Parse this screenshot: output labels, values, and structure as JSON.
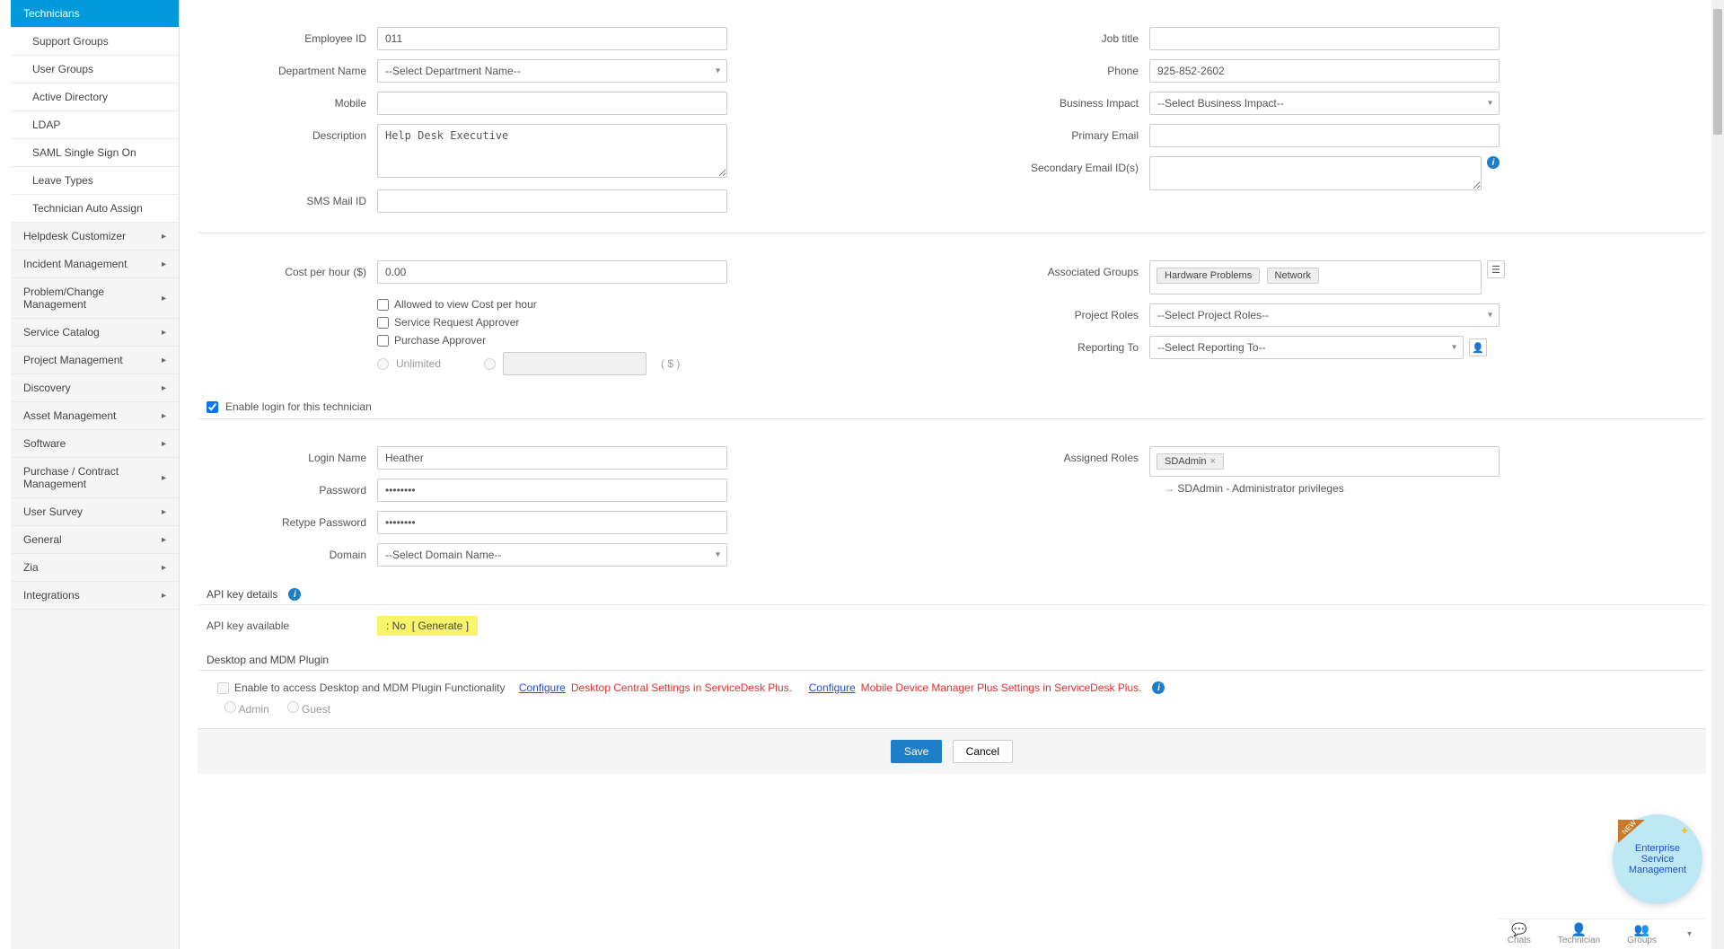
{
  "sidebar": {
    "items": [
      {
        "label": "Technicians",
        "active": true,
        "sub": false,
        "arrow": false
      },
      {
        "label": "Support Groups",
        "active": false,
        "sub": true,
        "arrow": false
      },
      {
        "label": "User Groups",
        "active": false,
        "sub": true,
        "arrow": false
      },
      {
        "label": "Active Directory",
        "active": false,
        "sub": true,
        "arrow": false
      },
      {
        "label": "LDAP",
        "active": false,
        "sub": true,
        "arrow": false
      },
      {
        "label": "SAML Single Sign On",
        "active": false,
        "sub": true,
        "arrow": false
      },
      {
        "label": "Leave Types",
        "active": false,
        "sub": true,
        "arrow": false
      },
      {
        "label": "Technician Auto Assign",
        "active": false,
        "sub": true,
        "arrow": false
      },
      {
        "label": "Helpdesk Customizer",
        "active": false,
        "sub": false,
        "arrow": true
      },
      {
        "label": "Incident Management",
        "active": false,
        "sub": false,
        "arrow": true
      },
      {
        "label": "Problem/Change Management",
        "active": false,
        "sub": false,
        "arrow": true
      },
      {
        "label": "Service Catalog",
        "active": false,
        "sub": false,
        "arrow": true
      },
      {
        "label": "Project Management",
        "active": false,
        "sub": false,
        "arrow": true
      },
      {
        "label": "Discovery",
        "active": false,
        "sub": false,
        "arrow": true
      },
      {
        "label": "Asset Management",
        "active": false,
        "sub": false,
        "arrow": true
      },
      {
        "label": "Software",
        "active": false,
        "sub": false,
        "arrow": true
      },
      {
        "label": "Purchase / Contract Management",
        "active": false,
        "sub": false,
        "arrow": true
      },
      {
        "label": "User Survey",
        "active": false,
        "sub": false,
        "arrow": true
      },
      {
        "label": "General",
        "active": false,
        "sub": false,
        "arrow": true
      },
      {
        "label": "Zia",
        "active": false,
        "sub": false,
        "arrow": true
      },
      {
        "label": "Integrations",
        "active": false,
        "sub": false,
        "arrow": true
      }
    ]
  },
  "left": {
    "employee_id": {
      "label": "Employee ID",
      "value": "011"
    },
    "department": {
      "label": "Department Name",
      "placeholder": "--Select Department Name--"
    },
    "mobile": {
      "label": "Mobile",
      "value": ""
    },
    "description": {
      "label": "Description",
      "value": "Help Desk Executive"
    },
    "sms_mail": {
      "label": "SMS Mail ID",
      "value": ""
    },
    "cost_per_hour": {
      "label": "Cost per hour ($)",
      "value": "0.00"
    },
    "checks": {
      "view_cost": "Allowed to view Cost per hour",
      "sr_approver": "Service Request Approver",
      "purchase_approver": "Purchase Approver"
    },
    "limit": {
      "unlimited_label": "Unlimited",
      "suffix": "( $ )"
    }
  },
  "right": {
    "job_title": {
      "label": "Job title",
      "value": ""
    },
    "phone": {
      "label": "Phone",
      "value": "925-852-2602"
    },
    "business_impact": {
      "label": "Business Impact",
      "placeholder": "--Select Business Impact--"
    },
    "primary_email": {
      "label": "Primary Email",
      "value": ""
    },
    "secondary_email": {
      "label": "Secondary Email ID(s)",
      "value": ""
    },
    "associated_groups": {
      "label": "Associated Groups",
      "tags": [
        "Hardware Problems",
        "Network"
      ]
    },
    "project_roles": {
      "label": "Project Roles",
      "placeholder": "--Select Project Roles--"
    },
    "reporting_to": {
      "label": "Reporting To",
      "placeholder": "--Select Reporting To--"
    }
  },
  "login": {
    "enable_label": "Enable login for this technician",
    "login_name": {
      "label": "Login Name",
      "value": "Heather"
    },
    "password": {
      "label": "Password",
      "value": "••••••••"
    },
    "retype": {
      "label": "Retype Password",
      "value": "••••••••"
    },
    "domain": {
      "label": "Domain",
      "placeholder": "--Select Domain Name--"
    },
    "assigned_roles": {
      "label": "Assigned Roles",
      "tags": [
        "SDAdmin"
      ]
    },
    "role_note": "SDAdmin - Administrator privileges"
  },
  "api": {
    "details_label": "API key details",
    "available_label": "API key available",
    "available_value": ":   No",
    "generate_text": "[ Generate ]"
  },
  "plugin": {
    "heading": "Desktop and MDM Plugin",
    "enable_label": "Enable to access Desktop and MDM Plugin Functionality",
    "configure1_link": "Configure",
    "configure1_red": "Desktop Central Settings in ServiceDesk Plus.",
    "configure2_link": "Configure",
    "configure2_red": "Mobile Device Manager Plus Settings in ServiceDesk Plus.",
    "radio_admin": "Admin",
    "radio_guest": "Guest"
  },
  "buttons": {
    "save": "Save",
    "cancel": "Cancel"
  },
  "dock": {
    "chats": "Chats",
    "technician": "Technician",
    "groups": "Groups"
  },
  "esm": {
    "new": "NEW",
    "text": "Enterprise Service Management"
  }
}
